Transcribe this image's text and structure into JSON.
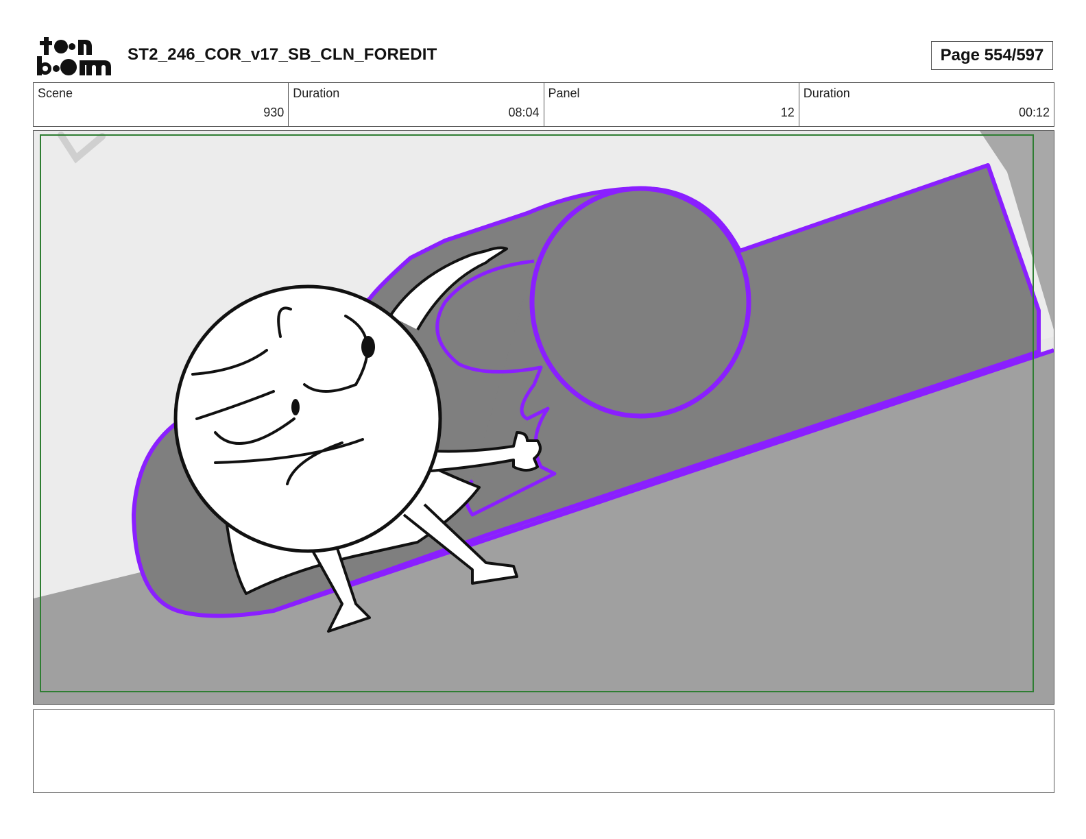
{
  "header": {
    "logo_text": "toon boom",
    "title": "ST2_246_COR_v17_SB_CLN_FOREDIT",
    "page": "Page 554/597"
  },
  "info": {
    "scene_label": "Scene",
    "scene_value": "930",
    "scene_duration_label": "Duration",
    "scene_duration_value": "08:04",
    "panel_label": "Panel",
    "panel_value": "12",
    "panel_duration_label": "Duration",
    "panel_duration_value": "00:12"
  },
  "colors": {
    "outline_purple": "#8a1fff",
    "safe_frame": "#2e7d32",
    "wall": "#e6e6e6",
    "floor": "#9e9e9e",
    "shadow": "#7f7f7f"
  },
  "notes": {
    "text": ""
  }
}
